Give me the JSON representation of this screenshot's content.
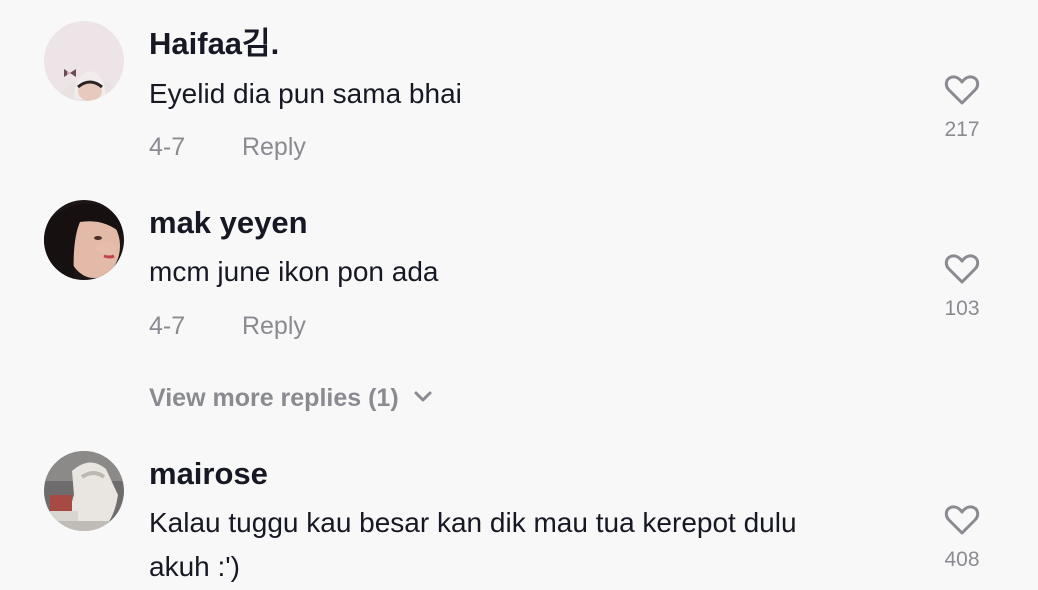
{
  "comments": [
    {
      "username": "Haifaa김.",
      "text": "Eyelid dia pun sama bhai",
      "date": "4-7",
      "reply_label": "Reply",
      "like_count": "217",
      "avatar": "avatar-girl-hijab-butterfly"
    },
    {
      "username": "mak yeyen",
      "text": "mcm june ikon pon ada",
      "date": "4-7",
      "reply_label": "Reply",
      "like_count": "103",
      "avatar": "avatar-woman-dark-hair"
    },
    {
      "username": "mairose",
      "text_lines": [
        "Kalau tuggu kau besar kan dik mau tua kerepot dulu",
        "akuh :')"
      ],
      "like_count": "408",
      "avatar": "avatar-figure-photo"
    }
  ],
  "view_more_replies": "View more replies (1)",
  "icons": {
    "like": "heart-outline-icon",
    "expand": "chevron-down-icon"
  },
  "colors": {
    "background": "#f8f8f8",
    "primary_text": "#161823",
    "secondary_text": "#8a8b91"
  }
}
